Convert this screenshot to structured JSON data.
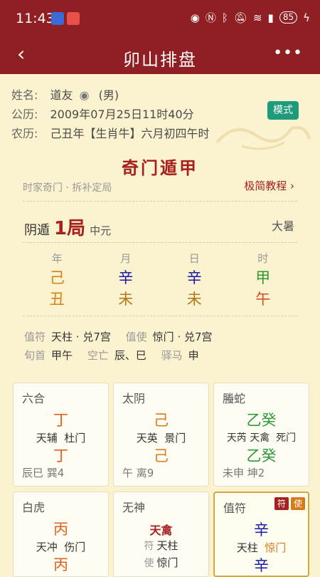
{
  "status": {
    "time": "11:43",
    "battery": "85"
  },
  "nav": {
    "title": "卯山排盘"
  },
  "profile": {
    "name_label": "姓名:",
    "name": "道友",
    "gender": "(男)",
    "solar_label": "公历:",
    "solar": "2009年07月25日11时40分",
    "lunar_label": "农历:",
    "lunar": "己丑年【生肖牛】六月初四午时",
    "mode_button": "模式"
  },
  "chart": {
    "title": "奇门遁甲",
    "subtitle": "时家奇门 · 拆补定局",
    "tutorial": "极简教程 ›",
    "dun": "阴遁",
    "ju": "1局",
    "yuan": "中元",
    "jieqi": "大暑"
  },
  "pillars": [
    {
      "label": "年",
      "gan": "己",
      "zhi": "丑",
      "gan_color": "#d9801a",
      "zhi_color": "#d9801a"
    },
    {
      "label": "月",
      "gan": "辛",
      "zhi": "未",
      "gan_color": "#1a1aa8",
      "zhi_color": "#b07a1a"
    },
    {
      "label": "日",
      "gan": "辛",
      "zhi": "未",
      "gan_color": "#1a1aa8",
      "zhi_color": "#b07a1a"
    },
    {
      "label": "时",
      "gan": "甲",
      "zhi": "午",
      "gan_color": "#2f9a3a",
      "zhi_color": "#d8502a"
    }
  ],
  "details": {
    "zhifu_label": "值符",
    "zhifu": "天柱 · 兑7宫",
    "zhishi_label": "值使",
    "zhishi": "惊门 · 兑7宫",
    "xunshou_label": "旬首",
    "xunshou": "甲午",
    "kongwang_label": "空亡",
    "kongwang": "辰、巳",
    "yima_label": "驿马",
    "yima": "申"
  },
  "palaces": [
    {
      "god": "六合",
      "top": "丁",
      "star": "天辅",
      "door": "杜门",
      "bottom": "丁",
      "footer": "辰巳 巽4",
      "color": "#e0601f"
    },
    {
      "god": "太阴",
      "top": "己",
      "star": "天英",
      "door": "景门",
      "bottom": "己",
      "footer": "午 离9",
      "color": "#d9801a"
    },
    {
      "god": "螣蛇",
      "top": "乙癸",
      "star": "天芮 天禽",
      "door": "死门",
      "bottom": "乙癸",
      "footer": "未申 坤2",
      "color": "#2f9a3a"
    },
    {
      "god": "白虎",
      "top": "丙",
      "star": "天冲",
      "door": "伤门",
      "bottom": "丙",
      "color": "#e0601f"
    },
    {
      "god": "无神",
      "top": "天禽",
      "fu_label": "符",
      "fu": "天柱",
      "shi_label": "使",
      "shi": "惊门"
    },
    {
      "god": "值符",
      "top": "辛",
      "star": "天柱",
      "door": "惊门",
      "bottom": "辛",
      "tag1": "符",
      "tag2": "使",
      "color": "#1a1aa8"
    }
  ]
}
